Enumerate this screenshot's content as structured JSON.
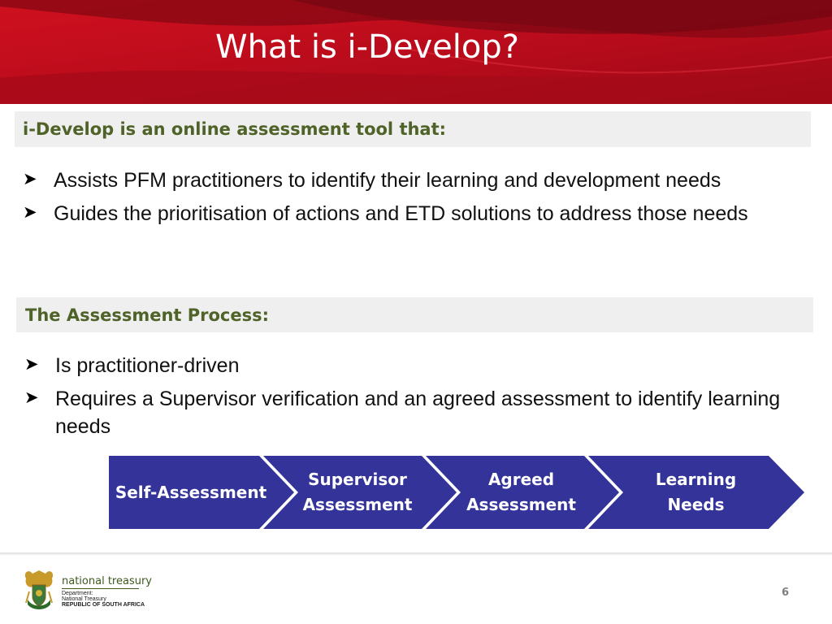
{
  "slide": {
    "title": "What is i-Develop?",
    "page_number": "6"
  },
  "section1": {
    "heading": "i-Develop is an online assessment tool that:",
    "bullets": [
      "Assists PFM practitioners to identify their learning and development needs",
      "Guides the prioritisation of actions and ETD solutions to address those needs"
    ]
  },
  "section2": {
    "heading": "The Assessment Process:",
    "bullets": [
      "Is practitioner-driven",
      "Requires a Supervisor verification and an agreed assessment to identify learning needs"
    ]
  },
  "process": {
    "steps": [
      {
        "line1": "Self-Assessment",
        "line2": ""
      },
      {
        "line1": "Supervisor",
        "line2": "Assessment"
      },
      {
        "line1": "Agreed",
        "line2": "Assessment"
      },
      {
        "line1": "Learning",
        "line2": "Needs"
      }
    ]
  },
  "footer": {
    "brand": "national treasury",
    "line1": "Department:",
    "line2": "National Treasury",
    "line3": "REPUBLIC OF SOUTH AFRICA"
  },
  "colors": {
    "banner_red": "#c00d1e",
    "banner_dark": "#8c0814",
    "heading_green": "#4f6228",
    "process_blue": "#333399"
  },
  "icons": {
    "bullet": "arrowhead-bullet-icon",
    "logo": "coat-of-arms-icon"
  }
}
